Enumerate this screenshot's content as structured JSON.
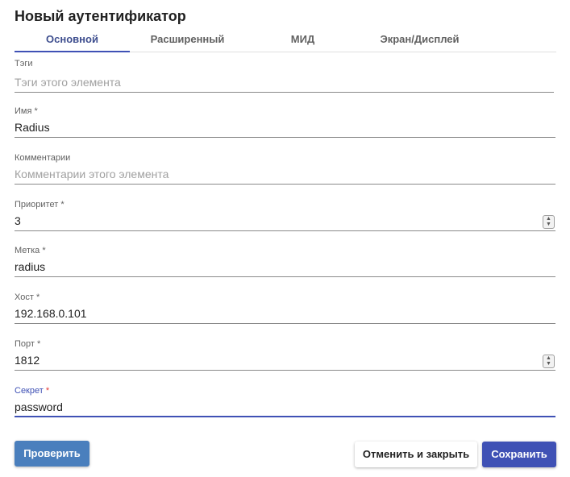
{
  "dialog": {
    "title": "Новый аутентификатор"
  },
  "tabs": [
    {
      "label": "Основной",
      "active": true
    },
    {
      "label": "Расширенный",
      "active": false
    },
    {
      "label": "МИД",
      "active": false
    },
    {
      "label": "Экран/Дисплей",
      "active": false
    }
  ],
  "fields": {
    "tags": {
      "label": "Тэги",
      "required": "",
      "value": "",
      "placeholder": "Тэги этого элемента"
    },
    "name": {
      "label": "Имя",
      "required": "*",
      "value": "Radius",
      "placeholder": ""
    },
    "comments": {
      "label": "Комментарии",
      "required": "",
      "value": "",
      "placeholder": "Комментарии этого элемента"
    },
    "priority": {
      "label": "Приоритет",
      "required": "*",
      "value": "3",
      "placeholder": ""
    },
    "label": {
      "label": "Метка",
      "required": "*",
      "value": "radius",
      "placeholder": ""
    },
    "host": {
      "label": "Хост",
      "required": "*",
      "value": "192.168.0.101",
      "placeholder": ""
    },
    "port": {
      "label": "Порт",
      "required": "*",
      "value": "1812",
      "placeholder": ""
    },
    "secret": {
      "label": "Секрет",
      "required": "*",
      "value": "password",
      "placeholder": ""
    }
  },
  "buttons": {
    "test": "Проверить",
    "cancel": "Отменить и закрыть",
    "save": "Сохранить"
  },
  "colors": {
    "accent": "#3f51b5",
    "test_button": "#4a7fbd",
    "required_focused": "#e53935"
  },
  "icons": {
    "spinner_up": "▲",
    "spinner_down": "▼"
  }
}
